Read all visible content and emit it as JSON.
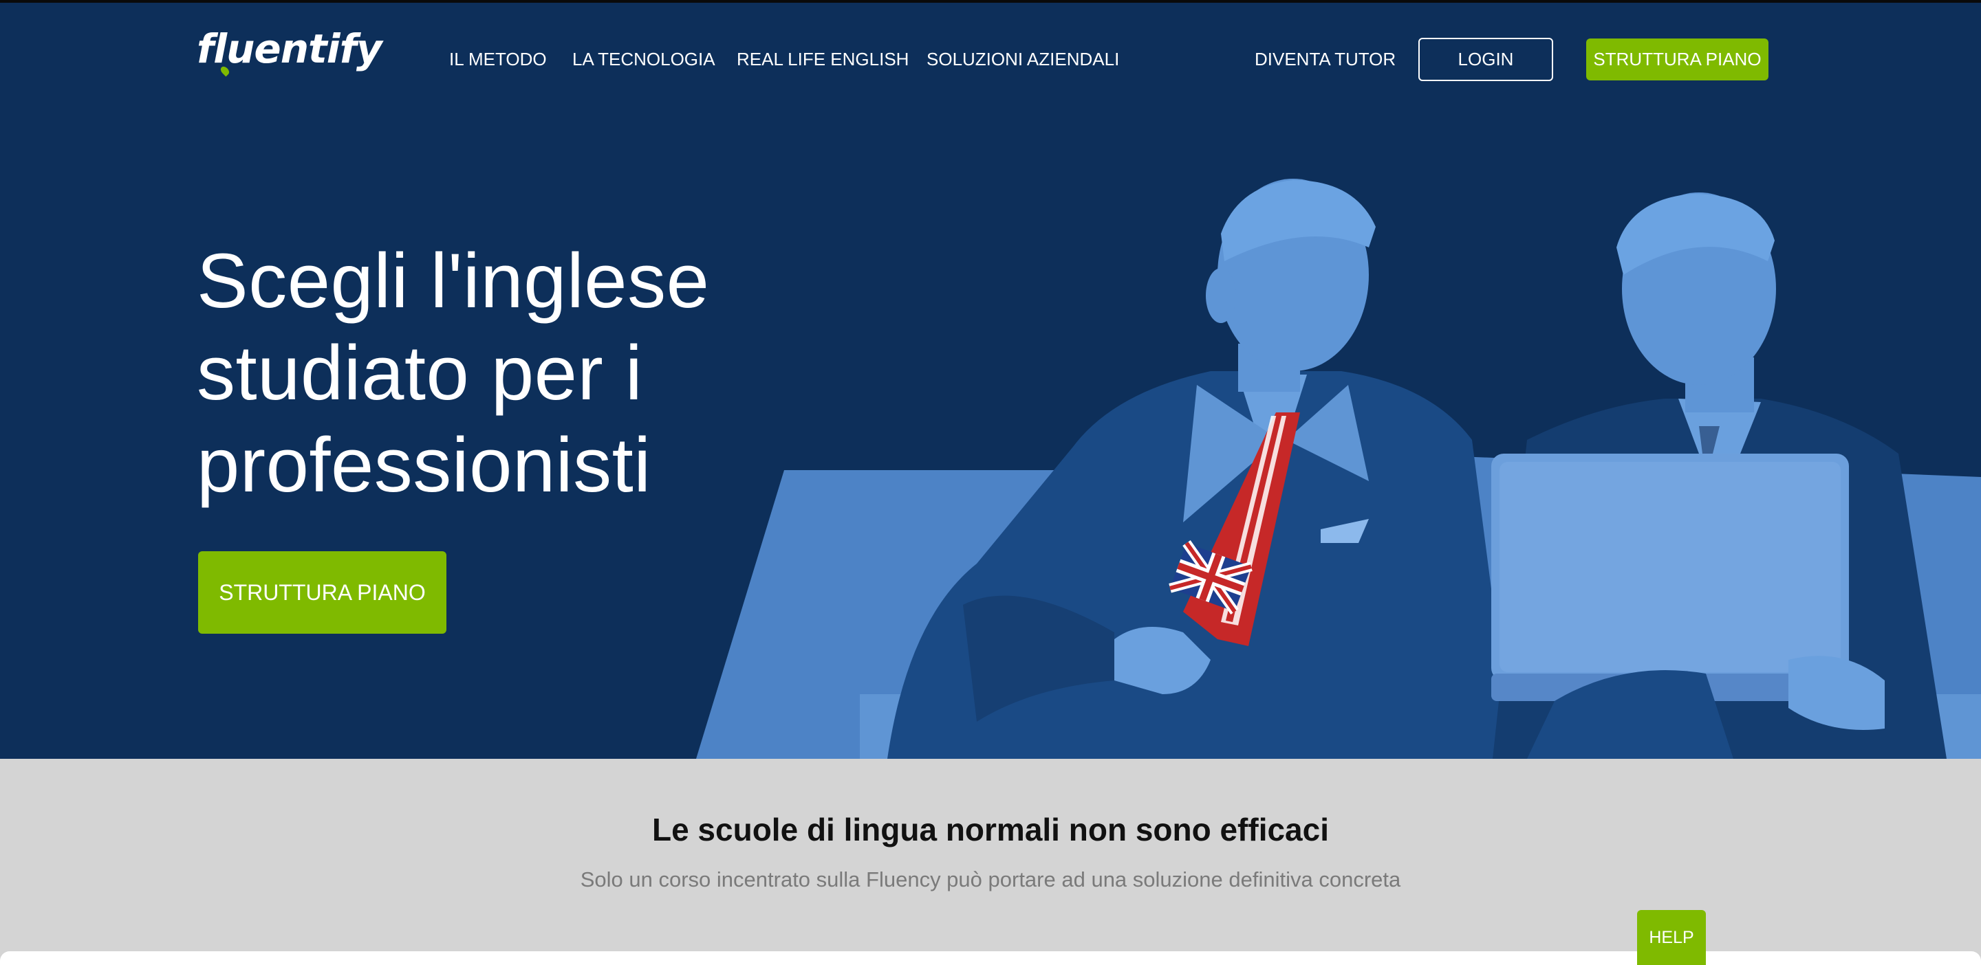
{
  "brand": {
    "logo_text": "fluentify",
    "accent_color": "#7fba00",
    "hero_bg": "#0d2f5a",
    "figure_color": "#5e95d6"
  },
  "nav": {
    "items": [
      {
        "label": "IL METODO"
      },
      {
        "label": "LA TECNOLOGIA"
      },
      {
        "label": "REAL LIFE ENGLISH"
      },
      {
        "label": "SOLUZIONI AZIENDALI"
      },
      {
        "label": "DIVENTA TUTOR"
      }
    ],
    "login_label": "LOGIN",
    "cta_label": "STRUTTURA PIANO"
  },
  "hero": {
    "title": "Scegli l'inglese studiato per i professionisti",
    "cta_label": "STRUTTURA PIANO",
    "image_icon": "business-men-illustration"
  },
  "section": {
    "title": "Le scuole di lingua normali non sono efficaci",
    "subtitle": "Solo un corso incentrato sulla Fluency può portare ad una soluzione definitiva concreta"
  },
  "help": {
    "label": "HELP"
  }
}
